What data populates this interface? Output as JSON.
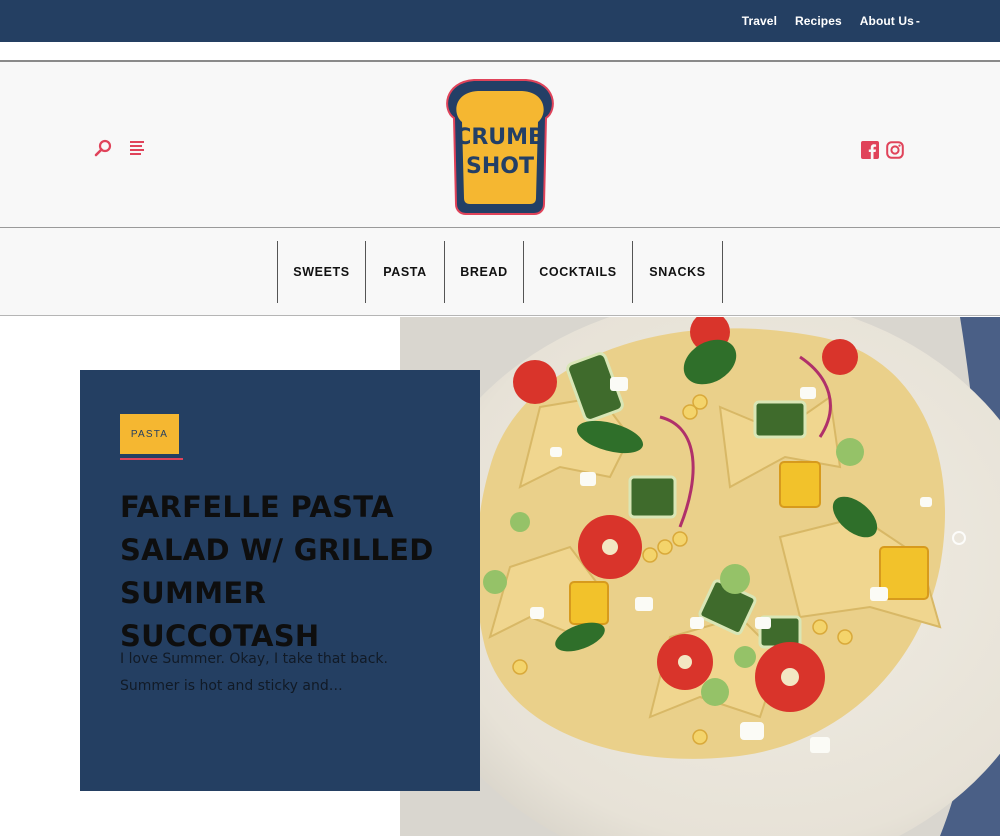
{
  "top_nav": {
    "items": [
      {
        "label": "Travel"
      },
      {
        "label": "Recipes"
      },
      {
        "label": "About Us"
      }
    ],
    "dropdown_marker": "-"
  },
  "header": {
    "logo": {
      "line1": "CRUMB",
      "line2": "SHOT",
      "colors": {
        "crust": "#233f66",
        "bread": "#f5b731",
        "outline": "#e0435a"
      }
    },
    "icons": [
      "search-icon",
      "menu-icon",
      "facebook-icon",
      "instagram-icon"
    ]
  },
  "categories": [
    {
      "label": "SWEETS"
    },
    {
      "label": "PASTA"
    },
    {
      "label": "BREAD"
    },
    {
      "label": "COCKTAILS"
    },
    {
      "label": "SNACKS"
    }
  ],
  "featured": {
    "tag": "PASTA",
    "title": "FARFELLE PASTA SALAD W/ GRILLED SUMMER SUCCOTASH",
    "excerpt": "I love Summer. Okay, I take that back. Summer is hot and sticky and…"
  },
  "colors": {
    "navy": "#243f62",
    "accent_red": "#e0435a",
    "accent_yellow": "#f5b731"
  }
}
